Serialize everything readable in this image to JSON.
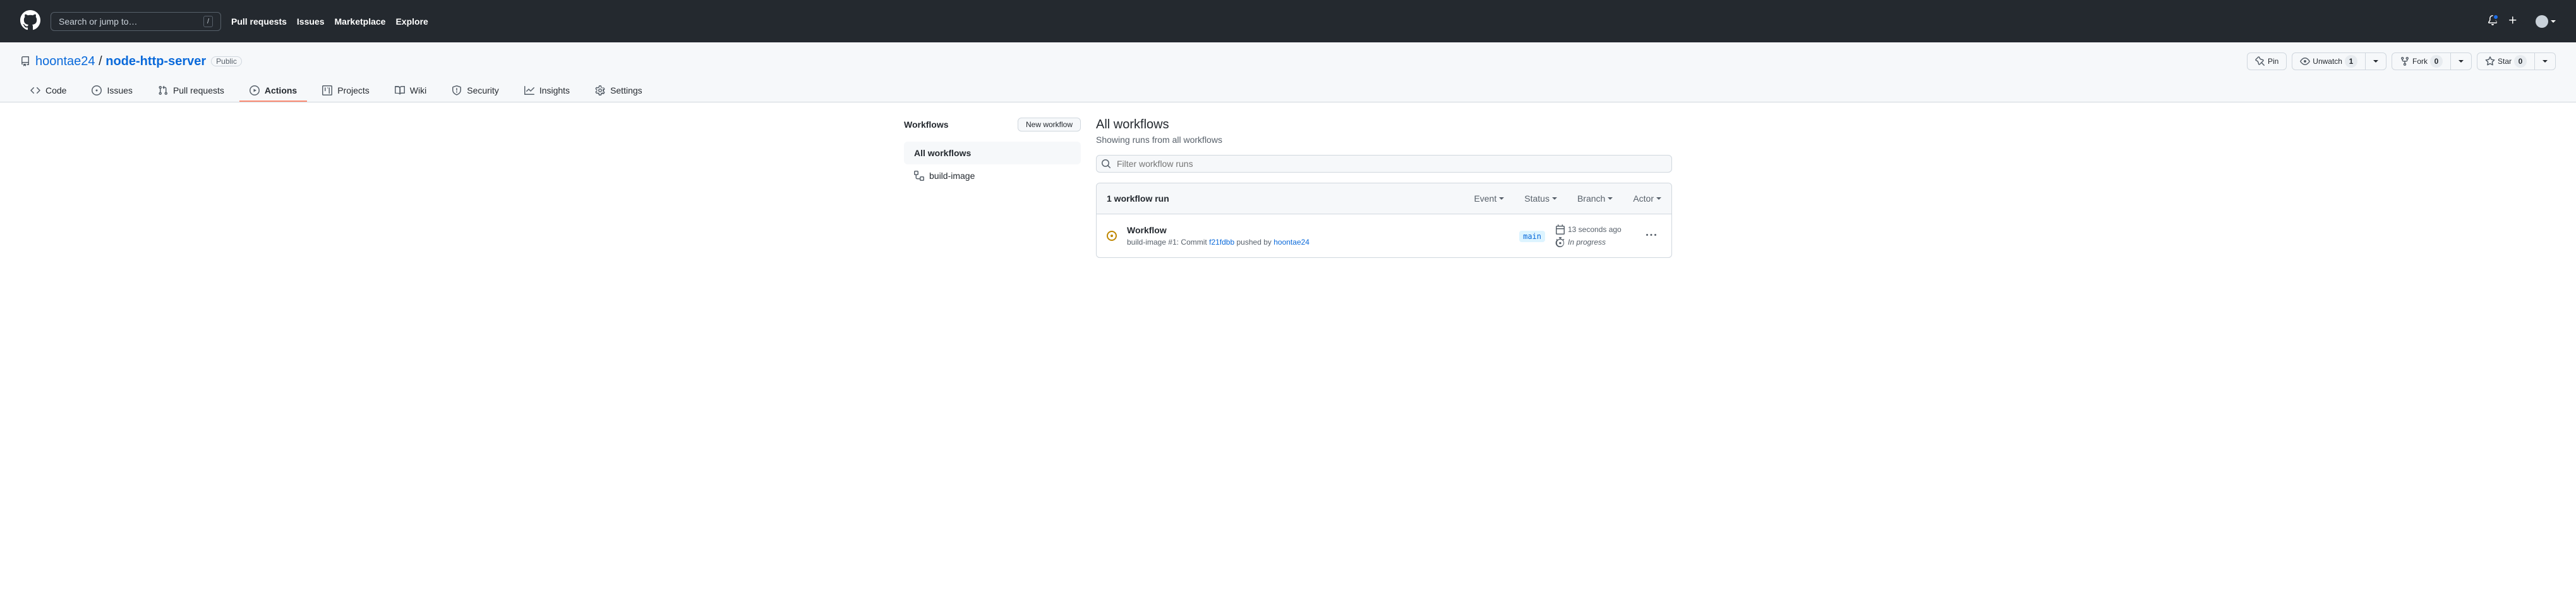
{
  "header": {
    "search_placeholder": "Search or jump to…",
    "search_key": "/",
    "nav": {
      "pull_requests": "Pull requests",
      "issues": "Issues",
      "marketplace": "Marketplace",
      "explore": "Explore"
    }
  },
  "repo": {
    "owner": "hoontae24",
    "separator": "/",
    "name": "node-http-server",
    "visibility": "Public",
    "actions": {
      "pin": "Pin",
      "unwatch": "Unwatch",
      "unwatch_count": "1",
      "fork": "Fork",
      "fork_count": "0",
      "star": "Star",
      "star_count": "0"
    },
    "tabs": {
      "code": "Code",
      "issues": "Issues",
      "pull_requests": "Pull requests",
      "actions": "Actions",
      "projects": "Projects",
      "wiki": "Wiki",
      "security": "Security",
      "insights": "Insights",
      "settings": "Settings"
    }
  },
  "sidebar": {
    "title": "Workflows",
    "new_button": "New workflow",
    "items": [
      {
        "label": "All workflows"
      },
      {
        "label": "build-image"
      }
    ]
  },
  "content": {
    "title": "All workflows",
    "subtitle": "Showing runs from all workflows",
    "filter_placeholder": "Filter workflow runs",
    "runs_count": "1 workflow run",
    "filters": {
      "event": "Event",
      "status": "Status",
      "branch": "Branch",
      "actor": "Actor"
    },
    "run": {
      "title": "Workflow",
      "workflow_name": "build-image",
      "run_number": "#1",
      "separator": ": ",
      "action": "Commit",
      "commit": "f21fdbb",
      "pushed_by": "pushed by",
      "actor": "hoontae24",
      "branch": "main",
      "timestamp": "13 seconds ago",
      "duration": "In progress"
    }
  }
}
